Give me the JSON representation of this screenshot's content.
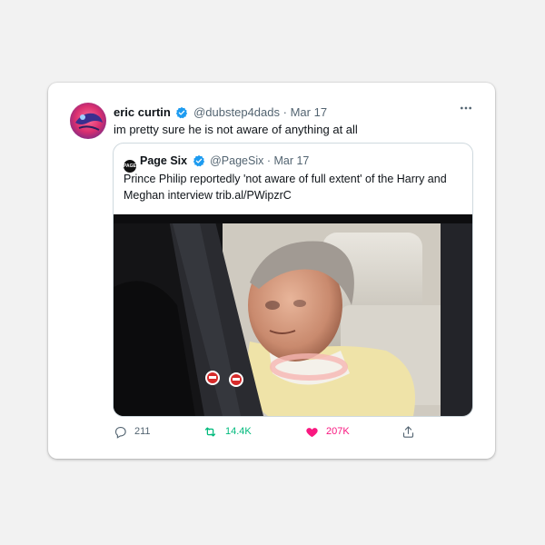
{
  "tweet": {
    "author_name": "eric curtin",
    "handle": "@dubstep4dads",
    "separator": "·",
    "date": "Mar 17",
    "text": "im pretty sure he is not aware of anything at all",
    "more_icon": "more-horizontal-icon"
  },
  "quoted": {
    "logo_text": "PAGE SIX",
    "author_name": "Page Six",
    "handle": "@PageSix",
    "separator": "·",
    "date": "Mar 17",
    "text": "Prince Philip reportedly 'not aware of full extent' of the Harry and Meghan interview trib.al/PWipzrC"
  },
  "actions": {
    "reply_count": "211",
    "retweet_count": "14.4K",
    "like_count": "207K"
  },
  "colors": {
    "verified": "#1d9bf0",
    "retweet": "#00ba7c",
    "like": "#f91880",
    "muted": "#536471"
  }
}
